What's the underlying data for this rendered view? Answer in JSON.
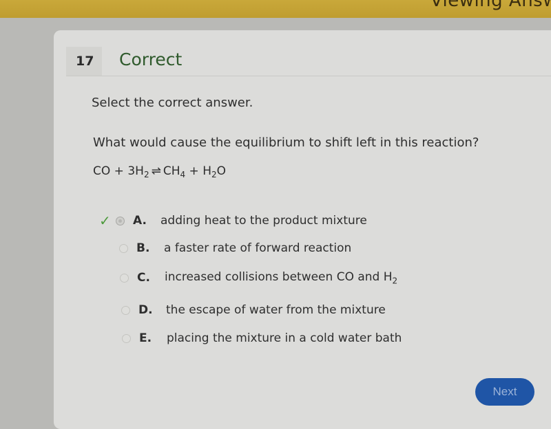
{
  "topbar": {
    "text": "Viewing Answ"
  },
  "question": {
    "number": "17",
    "status": "Correct",
    "instruction": "Select the correct answer.",
    "prompt": "What would cause the equilibrium to shift left in this reaction?",
    "equation": {
      "reactant1": "CO",
      "plus1": "+",
      "reactant2": "3H",
      "reactant2_sub": "2",
      "arrow": "⇌",
      "product1": "CH",
      "product1_sub": "4",
      "plus2": "+",
      "product2a": "H",
      "product2_sub": "2",
      "product2b": "O"
    }
  },
  "choices": [
    {
      "letter": "A.",
      "text": "adding heat to the product mixture",
      "selected": true,
      "correct": true
    },
    {
      "letter": "B.",
      "text": "a faster rate of forward reaction",
      "selected": false
    },
    {
      "letter": "C.",
      "text": "increased collisions between CO and H",
      "sub": "2",
      "selected": false
    },
    {
      "letter": "D.",
      "text": "the escape of water from the mixture",
      "selected": false
    },
    {
      "letter": "E.",
      "text": "placing the mixture in a cold water bath",
      "selected": false
    }
  ],
  "footer": {
    "next_label": "Next"
  },
  "icons": {
    "check": "✓"
  }
}
